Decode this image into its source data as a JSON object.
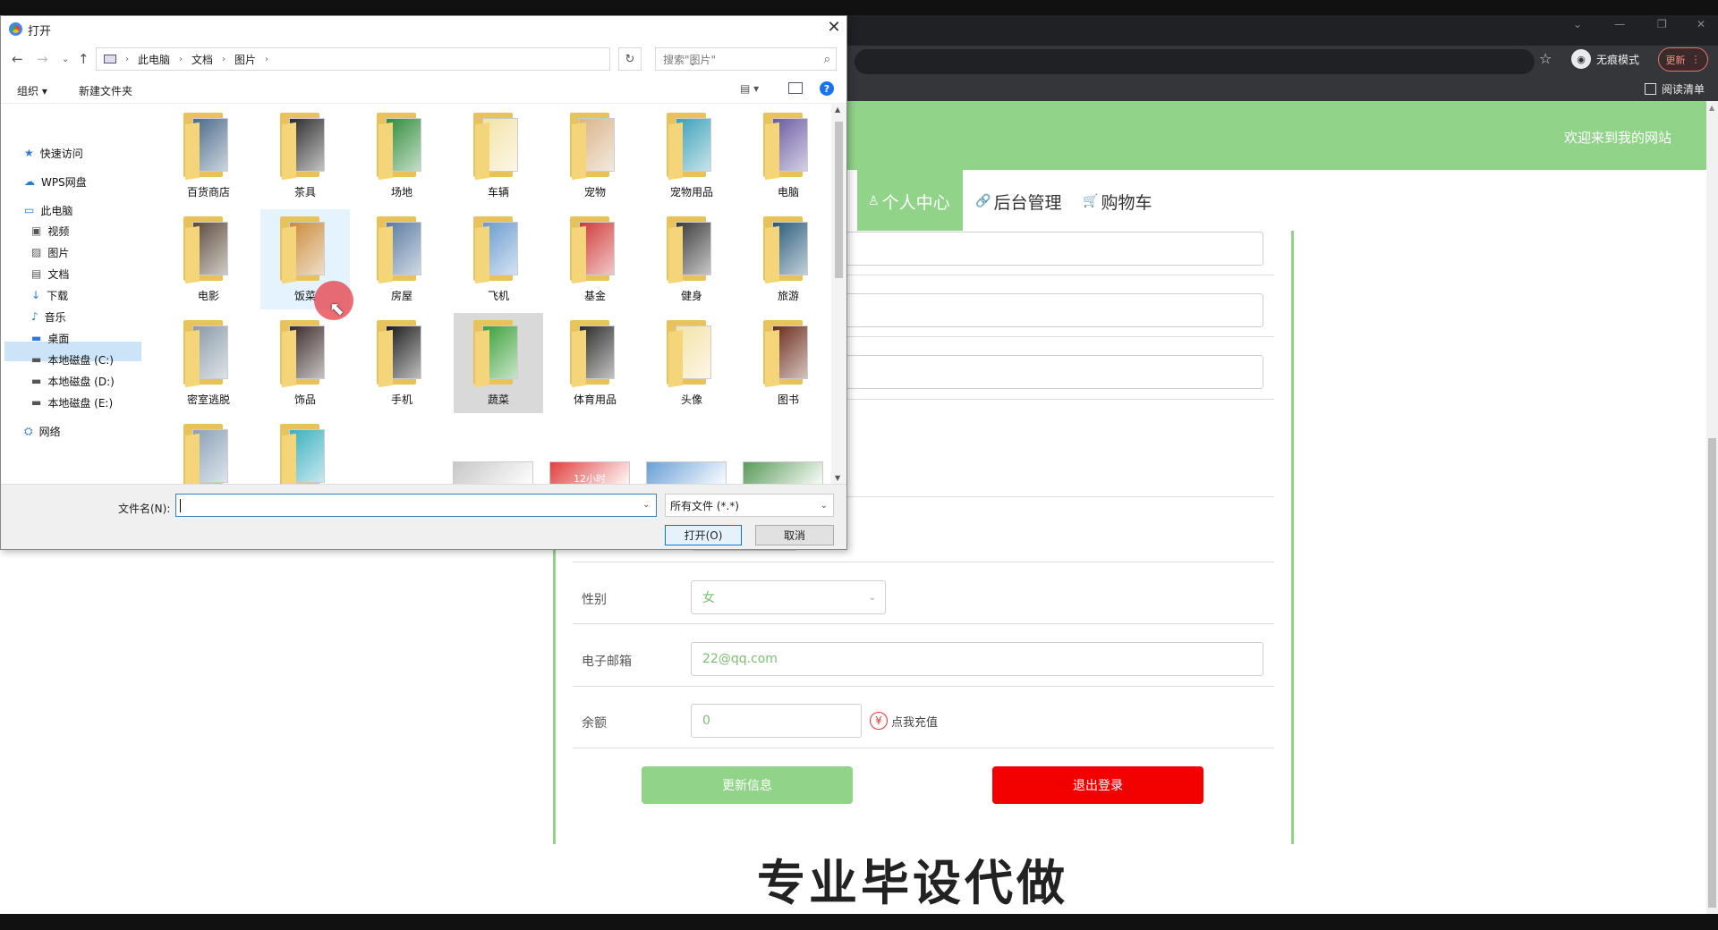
{
  "browser": {
    "incognito_label": "无痕模式",
    "update_label": "更新",
    "reading_list_label": "阅读清单"
  },
  "page": {
    "welcome": "欢迎来到我的网站",
    "nav": {
      "center": "个人中心",
      "admin": "后台管理",
      "cart": "购物车"
    },
    "form": {
      "gender_label": "性别",
      "gender_value": "女",
      "email_label": "电子邮箱",
      "email_value": "22@qq.com",
      "balance_label": "余额",
      "balance_value": "0",
      "recharge_symbol": "¥",
      "recharge_label": "点我充值",
      "update_button": "更新信息",
      "logout_button": "退出登录"
    },
    "caption": "专业毕设代做"
  },
  "dialog": {
    "title": "打开",
    "breadcrumb": [
      "此电脑",
      "文档",
      "图片"
    ],
    "search_placeholder": "搜索\"图片\"",
    "toolbar": {
      "organize": "组织 ▾",
      "new_folder": "新建文件夹",
      "help": "?"
    },
    "sidebar": [
      {
        "label": "快速访问",
        "icon": "star-icon"
      },
      {
        "label": "WPS网盘",
        "icon": "cloud-icon"
      },
      {
        "label": "此电脑",
        "icon": "computer-icon"
      },
      {
        "label": "视频",
        "icon": "video-icon"
      },
      {
        "label": "图片",
        "icon": "picture-icon"
      },
      {
        "label": "文档",
        "icon": "document-icon"
      },
      {
        "label": "下载",
        "icon": "download-icon"
      },
      {
        "label": "音乐",
        "icon": "music-icon"
      },
      {
        "label": "桌面",
        "icon": "desktop-icon"
      },
      {
        "label": "本地磁盘 (C:)",
        "icon": "drive-icon"
      },
      {
        "label": "本地磁盘 (D:)",
        "icon": "drive-icon"
      },
      {
        "label": "本地磁盘 (E:)",
        "icon": "drive-icon"
      },
      {
        "label": "网络",
        "icon": "network-icon"
      }
    ],
    "folders": [
      {
        "name": "百货商店",
        "color": "#4a6a8a"
      },
      {
        "name": "茶具",
        "color": "#2b2b2b"
      },
      {
        "name": "场地",
        "color": "#2e8b3a"
      },
      {
        "name": "车辆",
        "color": "#f3e3a8"
      },
      {
        "name": "宠物",
        "color": "#d8b48a"
      },
      {
        "name": "宠物用品",
        "color": "#3aa0b8"
      },
      {
        "name": "电脑",
        "color": "#6a5aa0"
      },
      {
        "name": "电影",
        "color": "#5a4a3a"
      },
      {
        "name": "饭菜",
        "color": "#c98a3a"
      },
      {
        "name": "房屋",
        "color": "#5a7aa0"
      },
      {
        "name": "飞机",
        "color": "#6a9ad0"
      },
      {
        "name": "基金",
        "color": "#d03a3a"
      },
      {
        "name": "健身",
        "color": "#3a3a3a"
      },
      {
        "name": "旅游",
        "color": "#2a5a7a"
      },
      {
        "name": "密室逃脱",
        "color": "#8a9aa8"
      },
      {
        "name": "饰品",
        "color": "#3a2a2a"
      },
      {
        "name": "手机",
        "color": "#1a1a1a"
      },
      {
        "name": "蔬菜",
        "color": "#3aa03a"
      },
      {
        "name": "体育用品",
        "color": "#2a2a2a"
      },
      {
        "name": "头像",
        "color": "#f3e3a8"
      },
      {
        "name": "图书",
        "color": "#6a2a1a"
      }
    ],
    "partial_folders": [
      {
        "color": "#8aa0b8"
      },
      {
        "color": "#3ab0c0"
      }
    ],
    "thumbnails": [
      {
        "text": "",
        "color": "#c8c8c8"
      },
      {
        "text": "12小时",
        "color": "#e04040"
      },
      {
        "text": "",
        "color": "#6aa0d8"
      },
      {
        "text": "",
        "color": "#5a9a5a"
      }
    ],
    "filename_label": "文件名(N):",
    "filename_value": "",
    "filetype_value": "所有文件 (*.*)",
    "open_button": "打开(O)",
    "cancel_button": "取消"
  }
}
